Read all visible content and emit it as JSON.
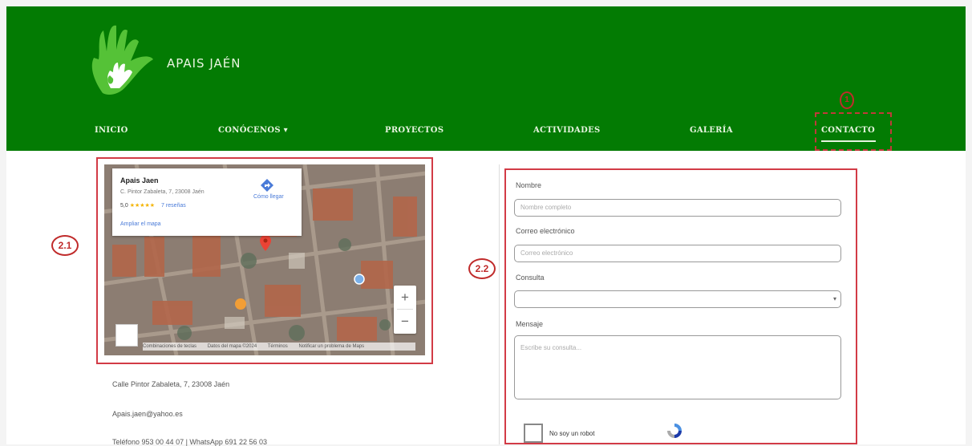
{
  "brand": {
    "name": "APAIS JAÉN"
  },
  "nav": {
    "items": [
      {
        "label": "INICIO"
      },
      {
        "label": "CONÓCENOS ▾"
      },
      {
        "label": "PROYECTOS"
      },
      {
        "label": "ACTIVIDADES"
      },
      {
        "label": "GALERÍA"
      },
      {
        "label": "CONTACTO",
        "active": true
      }
    ]
  },
  "annotations": {
    "one": "1",
    "map": "2.1",
    "form": "2.2"
  },
  "map": {
    "place_name": "Apais Jaen",
    "address": "C. Pintor Zabaleta, 7, 23008 Jaén",
    "rating": "5,0",
    "stars": "★★★★★",
    "reviews": "7 reseñas",
    "larger_map": "Ampliar el mapa",
    "directions": "Cómo llegar",
    "zoom_in": "+",
    "zoom_out": "−",
    "footer": [
      "Combinaciones de teclas",
      "Datos del mapa ©2024",
      "Términos",
      "Notificar un problema de Maps"
    ]
  },
  "contact": {
    "address": "Calle Pintor Zabaleta, 7, 23008 Jaén",
    "email": "Apais.jaen@yahoo.es",
    "phone": "Teléfono 953 00 44 07 | WhatsApp 691 22 56 03"
  },
  "form": {
    "name_label": "Nombre",
    "name_placeholder": "Nombre completo",
    "email_label": "Correo electrónico",
    "email_placeholder": "Correo electrónico",
    "subject_label": "Consulta",
    "subject_value": "",
    "message_label": "Mensaje",
    "message_placeholder": "Escribe su consulta...",
    "captcha_label": "No soy un robot"
  },
  "colors": {
    "header_green": "#037b03",
    "annotation_red": "#d23b46"
  }
}
